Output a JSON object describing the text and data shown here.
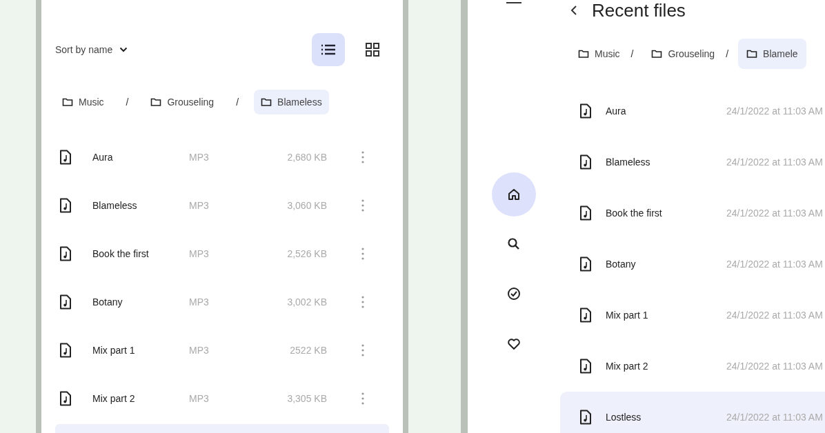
{
  "left_panel": {
    "sort": {
      "label": "Sort by name"
    },
    "view_toggle": [
      {
        "kind": "list",
        "selected": true
      },
      {
        "kind": "grid",
        "selected": false
      }
    ],
    "breadcrumbs": [
      {
        "label": "Music",
        "selected": false
      },
      {
        "separator": "/",
        "label": "Grouseling",
        "selected": false
      },
      {
        "separator": "/",
        "label": "Blameless",
        "selected": true
      }
    ],
    "files": [
      {
        "name": "Aura",
        "type": "MP3",
        "size": "2,680 KB"
      },
      {
        "name": "Blameless",
        "type": "MP3",
        "size": "3,060 KB"
      },
      {
        "name": "Book the first",
        "type": "MP3",
        "size": "2,526 KB"
      },
      {
        "name": "Botany",
        "type": "MP3",
        "size": "3,002 KB"
      },
      {
        "name": "Mix part 1",
        "type": "MP3",
        "size": "2522 KB"
      },
      {
        "name": "Mix part 2",
        "type": "MP3",
        "size": "3,305 KB"
      }
    ],
    "next_row": {
      "selected": true
    }
  },
  "right_panel": {
    "title": "Recent files",
    "nav": [
      {
        "kind": "home",
        "selected": true
      },
      {
        "kind": "search",
        "selected": false
      },
      {
        "kind": "check",
        "selected": false
      },
      {
        "kind": "heart",
        "selected": false
      }
    ],
    "breadcrumbs": [
      {
        "label": "Music",
        "selected": false
      },
      {
        "separator": "/",
        "label": "Grouseling",
        "selected": false
      },
      {
        "separator": "/",
        "label": "Blamele",
        "selected": true
      }
    ],
    "files": [
      {
        "name": "Aura",
        "date": "24/1/2022 at 11:03 AM",
        "selected": false
      },
      {
        "name": "Blameless",
        "date": "24/1/2022 at 11:03 AM",
        "selected": false
      },
      {
        "name": "Book the first",
        "date": "24/1/2022 at 11:03 AM",
        "selected": false
      },
      {
        "name": "Botany",
        "date": "24/1/2022 at 11:03 AM",
        "selected": false
      },
      {
        "name": "Mix part 1",
        "date": "24/1/2022 at 11:03 AM",
        "selected": false
      },
      {
        "name": "Mix part 2",
        "date": "24/1/2022 at 11:03 AM",
        "selected": false
      },
      {
        "name": "Lostless",
        "date": "24/1/2022 at 11:03 AM",
        "selected": true
      }
    ]
  }
}
